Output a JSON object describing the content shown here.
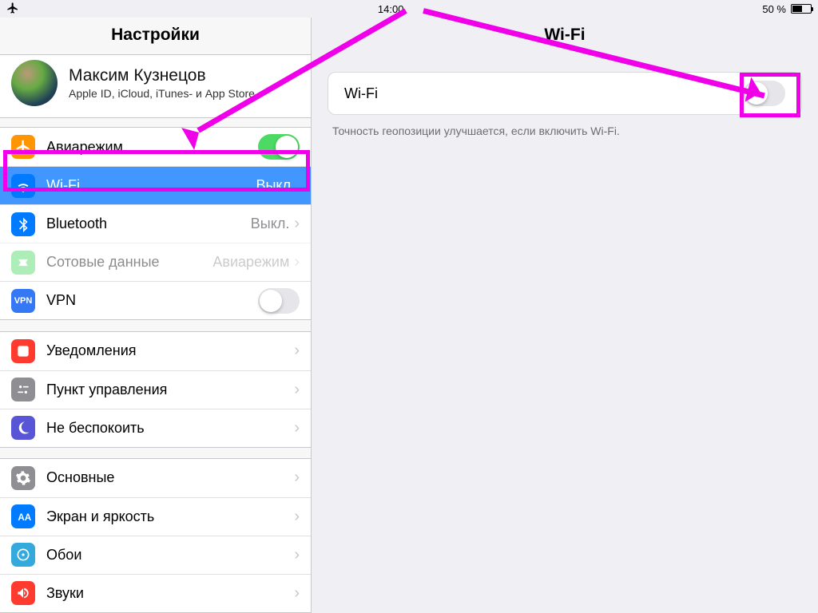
{
  "status": {
    "time": "14:00",
    "battery": "50 %"
  },
  "sidebar": {
    "title": "Настройки",
    "account": {
      "name": "Максим Кузнецов",
      "sub": "Apple ID, iCloud, iTunes- и App Store"
    },
    "group1": [
      {
        "k": "airplane",
        "label": "Авиарежим",
        "toggle": true,
        "on": true,
        "color": "orange"
      },
      {
        "k": "wifi",
        "label": "Wi-Fi",
        "value": "Выкл.",
        "selected": true,
        "color": "blue"
      },
      {
        "k": "bt",
        "label": "Bluetooth",
        "value": "Выкл.",
        "chev": true,
        "color": "blue"
      },
      {
        "k": "cell",
        "label": "Сотовые данные",
        "value": "Авиарежим",
        "chev": true,
        "dim": true,
        "color": "green"
      },
      {
        "k": "vpn",
        "label": "VPN",
        "toggle": true,
        "on": false,
        "vpn": true
      }
    ],
    "group2": [
      {
        "k": "notif",
        "label": "Уведомления",
        "chev": true,
        "color": "red"
      },
      {
        "k": "control",
        "label": "Пункт управления",
        "chev": true,
        "color": "gray"
      },
      {
        "k": "dnd",
        "label": "Не беспокоить",
        "chev": true,
        "color": "purple"
      }
    ],
    "group3": [
      {
        "k": "general",
        "label": "Основные",
        "chev": true,
        "color": "darkgray"
      },
      {
        "k": "display",
        "label": "Экран и яркость",
        "chev": true,
        "color": "bluew"
      },
      {
        "k": "wall",
        "label": "Обои",
        "chev": true,
        "color": "cyan"
      },
      {
        "k": "sound",
        "label": "Звуки",
        "chev": true,
        "color": "redw"
      }
    ]
  },
  "detail": {
    "title": "Wi-Fi",
    "row_label": "Wi-Fi",
    "footer": "Точность геопозиции улучшается, если включить Wi-Fi.",
    "toggle_on": false
  },
  "annotations": {
    "color": "#ef00e9"
  }
}
